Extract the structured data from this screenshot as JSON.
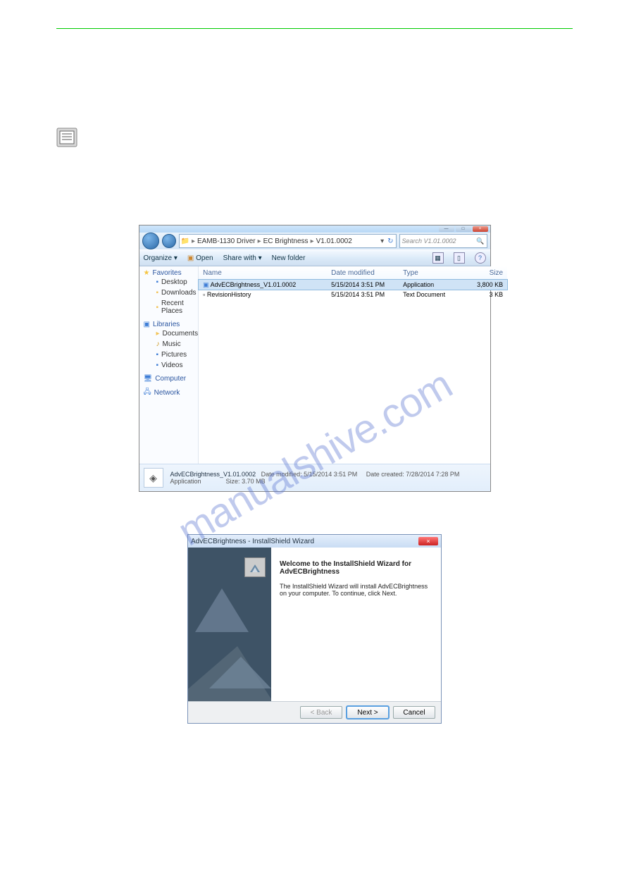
{
  "explorer": {
    "window_controls": {
      "min": "—",
      "max": "□",
      "close": "×"
    },
    "breadcrumb": [
      "EAMB-1130 Driver",
      "EC Brightness",
      "V1.01.0002"
    ],
    "search_placeholder": "Search V1.01.0002",
    "toolbar": {
      "organize": "Organize ▾",
      "open": "Open",
      "share": "Share with ▾",
      "newfolder": "New folder"
    },
    "sidebar": {
      "favorites": {
        "label": "Favorites",
        "items": [
          "Desktop",
          "Downloads",
          "Recent Places"
        ]
      },
      "libraries": {
        "label": "Libraries",
        "items": [
          "Documents",
          "Music",
          "Pictures",
          "Videos"
        ]
      },
      "computer": "Computer",
      "network": "Network"
    },
    "columns": {
      "name": "Name",
      "date": "Date modified",
      "type": "Type",
      "size": "Size"
    },
    "rows": [
      {
        "name": "AdvECBrightness_V1.01.0002",
        "date": "5/15/2014 3:51 PM",
        "type": "Application",
        "size": "3,800 KB",
        "selected": true
      },
      {
        "name": "RevisionHistory",
        "date": "5/15/2014 3:51 PM",
        "type": "Text Document",
        "size": "3 KB",
        "selected": false
      }
    ],
    "details": {
      "name": "AdvECBrightness_V1.01.0002",
      "subtitle": "Application",
      "modified_label": "Date modified:",
      "modified": "5/15/2014 3:51 PM",
      "size_label": "Size:",
      "size": "3.70 MB",
      "created_label": "Date created:",
      "created": "7/28/2014 7:28 PM"
    }
  },
  "wizard": {
    "title": "AdvECBrightness - InstallShield Wizard",
    "heading": "Welcome to the InstallShield Wizard for AdvECBrightness",
    "body": "The InstallShield Wizard will install AdvECBrightness on your computer.  To continue, click Next.",
    "back": "< Back",
    "next": "Next >",
    "cancel": "Cancel",
    "close": "×"
  },
  "watermark": "manualshive.com"
}
